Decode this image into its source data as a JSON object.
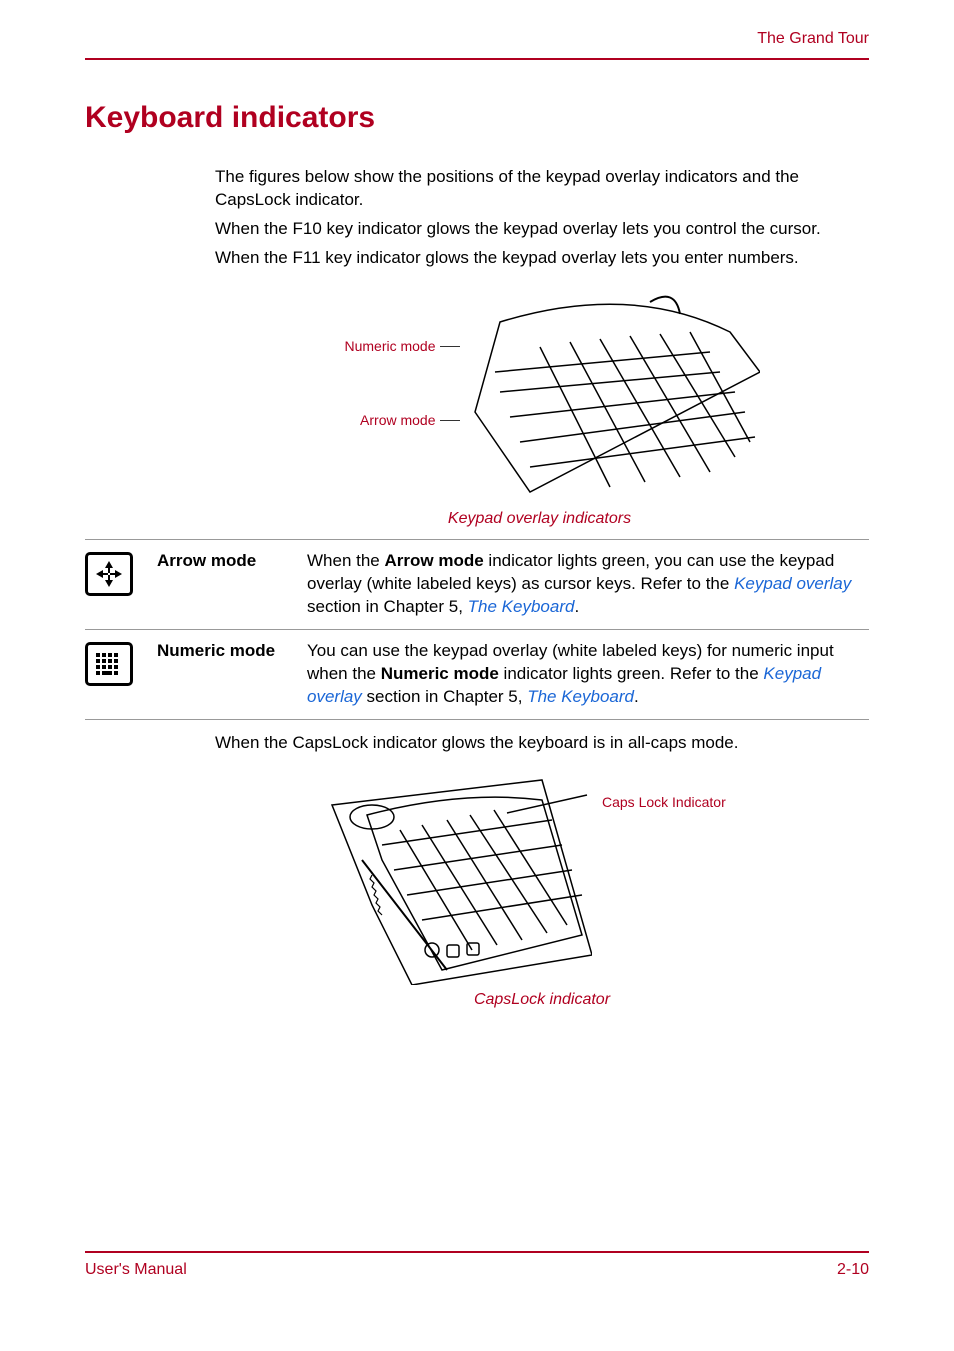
{
  "header": {
    "chapter": "The Grand Tour"
  },
  "section": {
    "title": "Keyboard indicators"
  },
  "intro": {
    "p1": "The figures below show the positions of the keypad overlay indicators and the CapsLock indicator.",
    "p2": "When the F10 key indicator glows the keypad overlay lets you control the cursor.",
    "p3": "When the F11 key indicator glows the keypad overlay lets you enter numbers."
  },
  "figure1": {
    "label_numeric": "Numeric mode",
    "label_arrow": "Arrow mode",
    "caption": "Keypad overlay indicators"
  },
  "table": {
    "rows": [
      {
        "icon": "arrow-mode-icon",
        "label": "Arrow mode",
        "desc_pre": "When the ",
        "desc_bold": "Arrow mode",
        "desc_mid": " indicator lights green, you can use the keypad overlay (white labeled keys) as cursor keys. Refer to the ",
        "link1": "Keypad overlay",
        "desc_mid2": " section in Chapter 5, ",
        "link2": "The Keyboard",
        "desc_end": "."
      },
      {
        "icon": "numeric-mode-icon",
        "label": "Numeric mode",
        "desc_pre": "You can use the keypad overlay (white labeled keys) for numeric input when the ",
        "desc_bold": "Numeric mode",
        "desc_mid": " indicator lights green. Refer to the ",
        "link1": "Keypad overlay",
        "desc_mid2": " section in Chapter 5, ",
        "link2": "The Keyboard",
        "desc_end": "."
      }
    ]
  },
  "capslock_para": "When the CapsLock indicator glows the keyboard is in all-caps mode.",
  "figure2": {
    "label": "Caps Lock Indicator",
    "caption": "CapsLock indicator"
  },
  "footer": {
    "left": "User's Manual",
    "right": "2-10"
  }
}
